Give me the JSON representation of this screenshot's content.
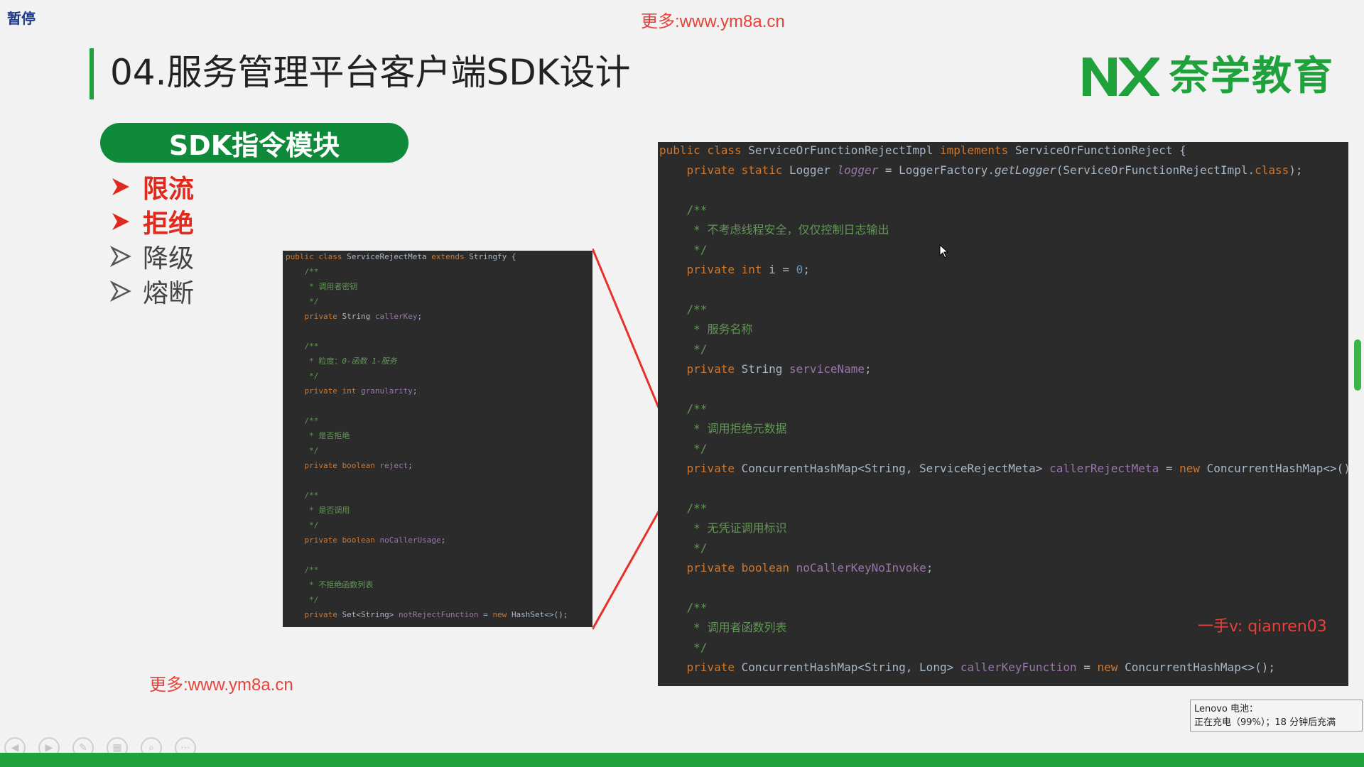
{
  "pause_label": "暂停",
  "watermark": "更多:www.ym8a.cn",
  "slide": {
    "title": "04.服务管理平台客户端SDK设计",
    "logo_text": "奈学教育",
    "module_title": "SDK指令模块",
    "menu": [
      {
        "label": "限流",
        "active": true
      },
      {
        "label": "拒绝",
        "active": true
      },
      {
        "label": "降级",
        "active": false
      },
      {
        "label": "熔断",
        "active": false
      }
    ],
    "wechat_note": "一手v: qianren03"
  },
  "code_small": {
    "class_name": "ServiceRejectMeta",
    "parent": "Stringfy",
    "c1": "* 调用者密钥",
    "f1_type": "String",
    "f1_name": "callerKey",
    "c2a": "* 粒度：",
    "c2b": "0-函数 1-服务",
    "f2_type": "int",
    "f2_name": "granularity",
    "c3": "* 是否拒绝",
    "f3_type": "boolean",
    "f3_name": "reject",
    "c4": "* 是否调用",
    "f4_type": "boolean",
    "f4_name": "noCallerUsage",
    "c5": "* 不拒绝函数列表",
    "f5_type": "Set<String>",
    "f5_name": "notRejectFunction",
    "f5_init": "HashSet<>();"
  },
  "code_large": {
    "class_name": "ServiceOrFunctionRejectImpl",
    "iface": "ServiceOrFunctionReject {",
    "logger_type": "Logger",
    "logger_name": "logger",
    "logger_factory": "LoggerFactory.",
    "logger_method": "getLogger",
    "logger_arg": "(ServiceOrFunctionRejectImpl.",
    "logger_end": ");",
    "c1": "* 不考虑线程安全，仅仅控制日志输出",
    "i_name": "i",
    "i_value": "0",
    "c2": "* 服务名称",
    "f2_type": "String",
    "f2_name": "serviceName",
    "c3": "* 调用拒绝元数据",
    "f3_type": "ConcurrentHashMap<String, ServiceRejectMeta>",
    "f3_name": "callerRejectMeta",
    "f3_init": "ConcurrentHashMap<>();",
    "c4": "* 无凭证调用标识",
    "f4_type": "boolean",
    "f4_name": "noCallerKeyNoInvoke",
    "c5": "* 调用者函数列表",
    "f5_type": "ConcurrentHashMap<String, Long>",
    "f5_name": "callerKeyFunction",
    "f5_init": "ConcurrentHashMap<>();"
  },
  "battery": {
    "line1": "Lenovo 电池：",
    "line2": "正在充电（99%）；18 分钟后充满"
  },
  "toolbar_icons": [
    "prev-icon",
    "next-icon",
    "pen-icon",
    "slides-icon",
    "zoom-icon",
    "more-icon"
  ],
  "colors": {
    "brand_green": "#1fa23b",
    "accent_red": "#e02a1e",
    "code_bg": "#2b2b2b"
  }
}
